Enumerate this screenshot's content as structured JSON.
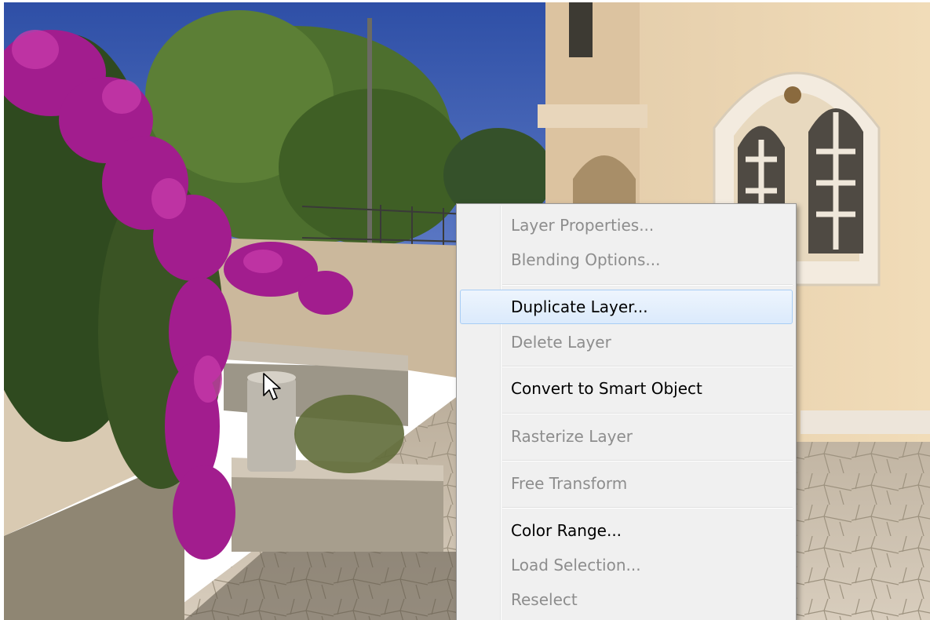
{
  "context_menu": {
    "items": [
      {
        "label": "Layer Properties...",
        "enabled": false
      },
      {
        "label": "Blending Options...",
        "enabled": false
      },
      {
        "label": "Duplicate Layer...",
        "enabled": true,
        "highlighted": true
      },
      {
        "label": "Delete Layer",
        "enabled": false
      },
      {
        "label": "Convert to Smart Object",
        "enabled": true
      },
      {
        "label": "Rasterize Layer",
        "enabled": false
      },
      {
        "label": "Free Transform",
        "enabled": false
      },
      {
        "label": "Color Range...",
        "enabled": true
      },
      {
        "label": "Load Selection...",
        "enabled": false
      },
      {
        "label": "Reselect",
        "enabled": false
      }
    ]
  },
  "icons": {
    "cursor": "arrow-cursor-icon"
  },
  "colors": {
    "menu_background": "#f0f0f0",
    "highlight_border": "#a8cdf5",
    "disabled_text": "#8d8d8d",
    "enabled_text": "#000000"
  }
}
